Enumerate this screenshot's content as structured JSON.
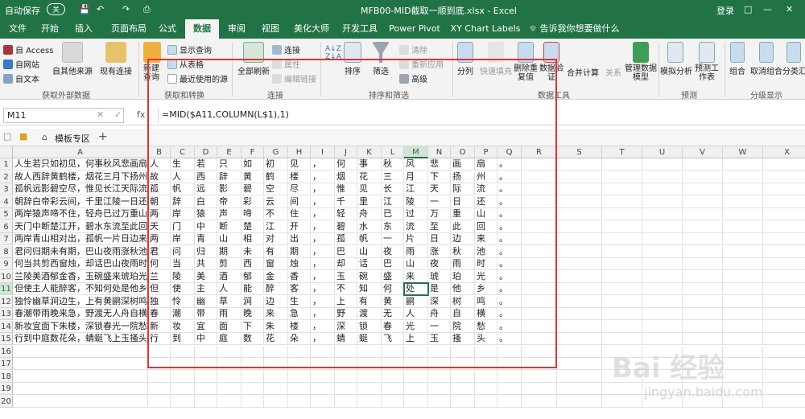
{
  "titlebar": {
    "autosave": "自动保存",
    "autosave_state": "关",
    "filename": "MFB00-MID截取一顺到底.xlsx - Excel",
    "login": "登录"
  },
  "tabs": [
    "文件",
    "开始",
    "插入",
    "页面布局",
    "公式",
    "数据",
    "审阅",
    "视图",
    "美化大师",
    "开发工具",
    "Power Pivot",
    "XY Chart Labels",
    "告诉我你想要做什么"
  ],
  "ribbon": {
    "ext": {
      "access": "自 Access",
      "web": "自网站",
      "text": "自文本",
      "other": "自其他来源",
      "existing": "现有连接",
      "group": "获取外部数据"
    },
    "gt": {
      "new_query": "新建查询",
      "show_query": "显示查询",
      "from_table": "从表格",
      "recent": "最近使用的源",
      "group": "获取和转换"
    },
    "conn": {
      "refresh_all": "全部刷新",
      "connections": "连接",
      "properties": "属性",
      "edit_links": "编辑链接",
      "group": "连接"
    },
    "sort": {
      "sort": "排序",
      "filter": "筛选",
      "clear": "清除",
      "reapply": "重新应用",
      "advanced": "高级",
      "group": "排序和筛选"
    },
    "tools": {
      "split": "分列",
      "flash": "快速填充",
      "dedup": "删除重复值",
      "validate": "数据验证",
      "consolidate": "合并计算",
      "relations": "关系",
      "datamodel": "管理数据模型",
      "group": "数据工具"
    },
    "forecast": {
      "whatif": "模拟分析",
      "sheet": "预测工作表",
      "group": "预测"
    },
    "outline": {
      "group_btn": "组合",
      "ungroup": "取消组合",
      "subtotal": "分类汇",
      "group": "分级显示"
    }
  },
  "formula_bar": {
    "name_box": "M11",
    "fx": "fx",
    "formula": "=MID($A11,COLUMN(L$1),1)"
  },
  "template_bar": {
    "label": "模板专区",
    "plus": "+"
  },
  "columns": [
    "A",
    "B",
    "C",
    "D",
    "E",
    "F",
    "G",
    "H",
    "I",
    "J",
    "K",
    "L",
    "M",
    "N",
    "O",
    "P",
    "Q",
    "R",
    "S",
    "T",
    "U",
    "V",
    "W",
    "X"
  ],
  "rows": [
    {
      "a": "人生若只如初见，何事秋风悲画扇。",
      "c": [
        "人",
        "生",
        "若",
        "只",
        "如",
        "初",
        "见",
        "，",
        "何",
        "事",
        "秋",
        "风",
        "悲",
        "画",
        "扇",
        "。"
      ]
    },
    {
      "a": "故人西辞黄鹤楼，烟花三月下扬州。",
      "c": [
        "故",
        "人",
        "西",
        "辞",
        "黄",
        "鹤",
        "楼",
        "，",
        "烟",
        "花",
        "三",
        "月",
        "下",
        "扬",
        "州",
        "。"
      ]
    },
    {
      "a": "孤帆远影碧空尽，惟见长江天际流。",
      "c": [
        "孤",
        "帆",
        "远",
        "影",
        "碧",
        "空",
        "尽",
        "，",
        "惟",
        "见",
        "长",
        "江",
        "天",
        "际",
        "流",
        "。"
      ]
    },
    {
      "a": "朝辞白帝彩云间，千里江陵一日还。",
      "c": [
        "朝",
        "辞",
        "白",
        "帝",
        "彩",
        "云",
        "间",
        "，",
        "千",
        "里",
        "江",
        "陵",
        "一",
        "日",
        "还",
        "。"
      ]
    },
    {
      "a": "两岸猿声啼不住，轻舟已过万重山。",
      "c": [
        "两",
        "岸",
        "猿",
        "声",
        "啼",
        "不",
        "住",
        "，",
        "轻",
        "舟",
        "已",
        "过",
        "万",
        "重",
        "山",
        "。"
      ]
    },
    {
      "a": "天门中断楚江开，碧水东流至此回。",
      "c": [
        "天",
        "门",
        "中",
        "断",
        "楚",
        "江",
        "开",
        "，",
        "碧",
        "水",
        "东",
        "流",
        "至",
        "此",
        "回",
        "。"
      ]
    },
    {
      "a": "两岸青山相对出，孤帆一片日边来。",
      "c": [
        "两",
        "岸",
        "青",
        "山",
        "相",
        "对",
        "出",
        "，",
        "孤",
        "帆",
        "一",
        "片",
        "日",
        "边",
        "来",
        "。"
      ]
    },
    {
      "a": "君问归期未有期，巴山夜雨涨秋池。",
      "c": [
        "君",
        "问",
        "归",
        "期",
        "未",
        "有",
        "期",
        "，",
        "巴",
        "山",
        "夜",
        "雨",
        "涨",
        "秋",
        "池",
        "。"
      ]
    },
    {
      "a": "何当共剪西窗烛，却话巴山夜雨时。",
      "c": [
        "何",
        "当",
        "共",
        "剪",
        "西",
        "窗",
        "烛",
        "，",
        "却",
        "话",
        "巴",
        "山",
        "夜",
        "雨",
        "时",
        "。"
      ]
    },
    {
      "a": "兰陵美酒郁金香，玉碗盛来琥珀光。",
      "c": [
        "兰",
        "陵",
        "美",
        "酒",
        "郁",
        "金",
        "香",
        "，",
        "玉",
        "碗",
        "盛",
        "来",
        "琥",
        "珀",
        "光",
        "。"
      ]
    },
    {
      "a": "但使主人能醉客，不知何处是他乡。",
      "c": [
        "但",
        "使",
        "主",
        "人",
        "能",
        "醉",
        "客",
        "，",
        "不",
        "知",
        "何",
        "处",
        "是",
        "他",
        "乡",
        "。"
      ]
    },
    {
      "a": "独怜幽草涧边生，上有黄鹂深树鸣。",
      "c": [
        "独",
        "怜",
        "幽",
        "草",
        "涧",
        "边",
        "生",
        "，",
        "上",
        "有",
        "黄",
        "鹂",
        "深",
        "树",
        "鸣",
        "。"
      ]
    },
    {
      "a": "春潮带雨晚来急，野渡无人舟自横。",
      "c": [
        "春",
        "潮",
        "带",
        "雨",
        "晚",
        "来",
        "急",
        "，",
        "野",
        "渡",
        "无",
        "人",
        "舟",
        "自",
        "横",
        "。"
      ]
    },
    {
      "a": "新妆宜面下朱楼，深锁春光一院愁。",
      "c": [
        "新",
        "妆",
        "宜",
        "面",
        "下",
        "朱",
        "楼",
        "，",
        "深",
        "锁",
        "春",
        "光",
        "一",
        "院",
        "愁",
        "。"
      ]
    },
    {
      "a": "行到中庭数花朵，蜻蜓飞上玉搔头。",
      "c": [
        "行",
        "到",
        "中",
        "庭",
        "数",
        "花",
        "朵",
        "，",
        "蜻",
        "蜓",
        "飞",
        "上",
        "玉",
        "搔",
        "头",
        "。"
      ]
    },
    {
      "a": "",
      "c": []
    },
    {
      "a": "",
      "c": []
    },
    {
      "a": "",
      "c": []
    },
    {
      "a": "",
      "c": []
    },
    {
      "a": "",
      "c": []
    }
  ],
  "active_cell": {
    "row": 11,
    "col": "M"
  },
  "watermark": {
    "text": "Bai 经验",
    "url": "jingyan.baidu.com"
  }
}
